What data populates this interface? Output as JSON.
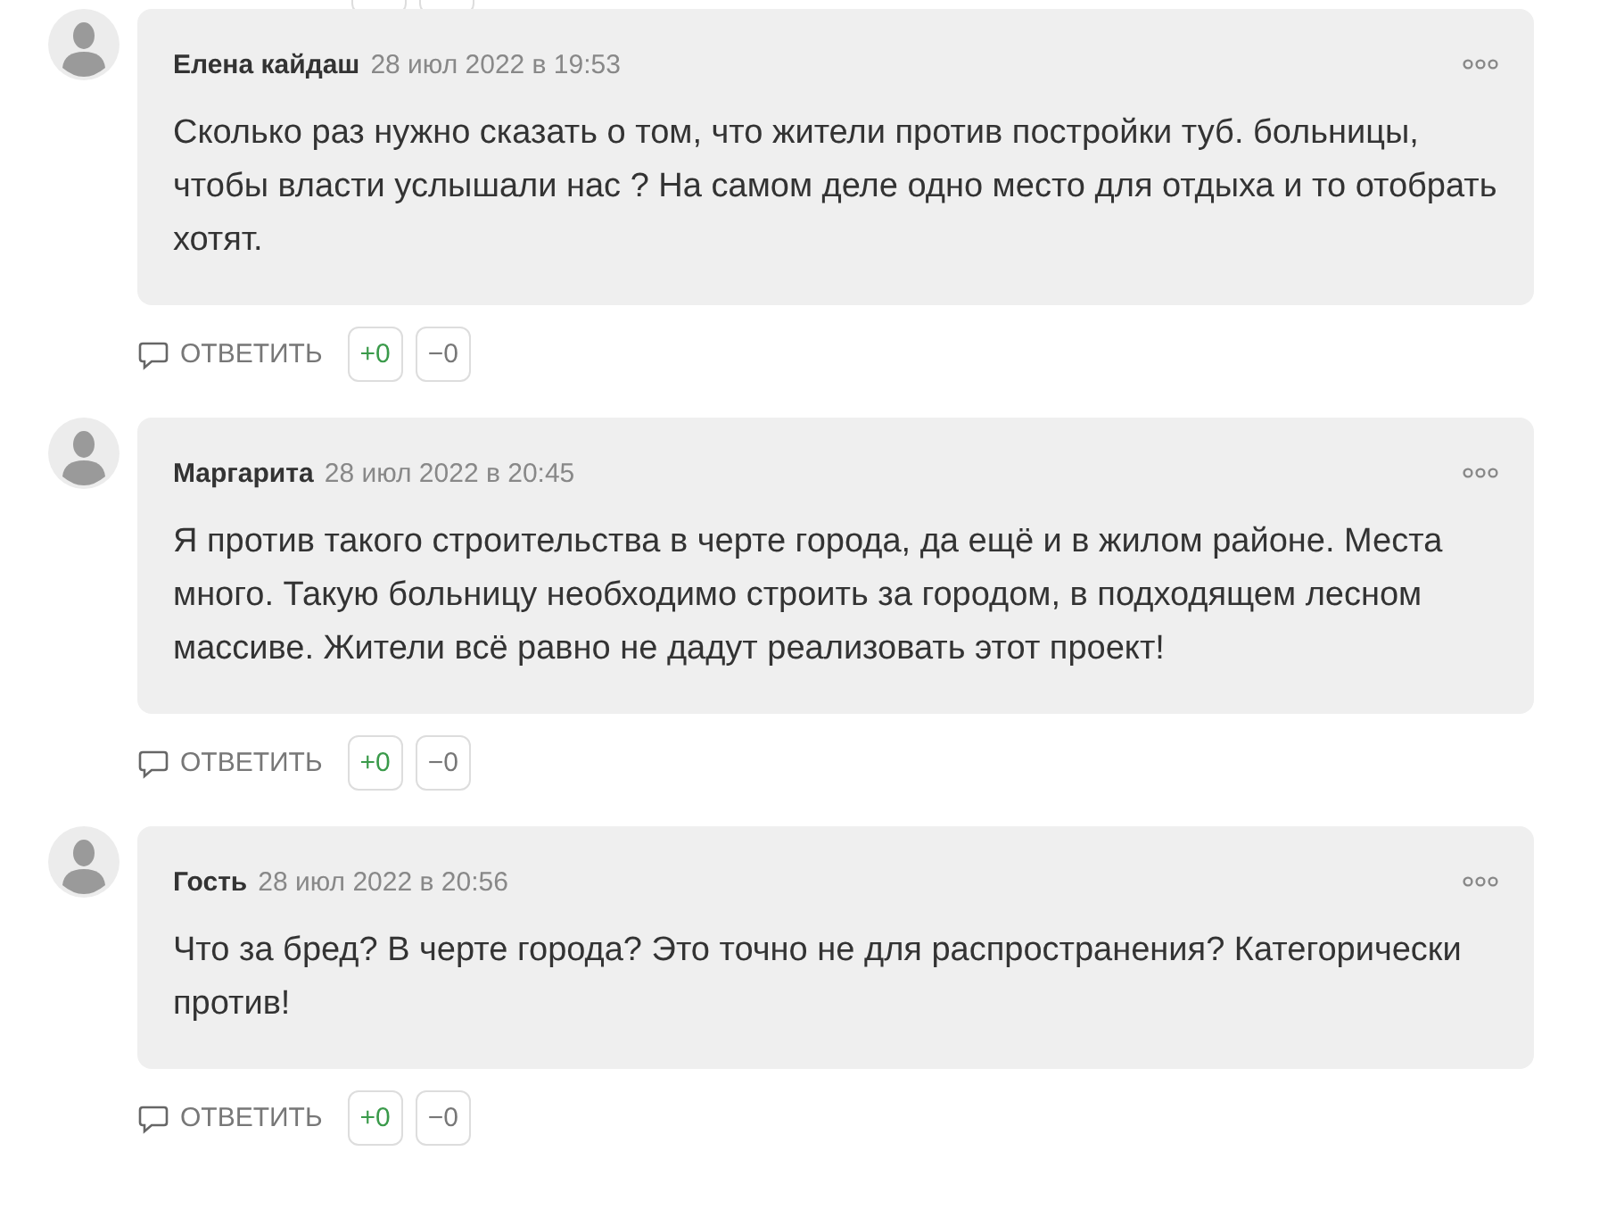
{
  "comments": [
    {
      "author": "Елена кайдаш",
      "date": "28 июл 2022 в 19:53",
      "text": "Сколько раз нужно сказать о том, что жители против постройки туб. больницы, чтобы власти услышали нас ? На самом деле одно место для отдыха и то отобрать хотят.",
      "reply": "ОТВЕТИТЬ",
      "upvotes": "+0",
      "downvotes": "−0"
    },
    {
      "author": "Маргарита",
      "date": "28 июл 2022 в 20:45",
      "text": "Я против такого строительства в черте города, да ещё и в жилом районе. Места много. Такую больницу необходимо строить за городом, в подходящем лесном массиве. Жители всё равно не дадут реализовать этот проект!",
      "reply": "ОТВЕТИТЬ",
      "upvotes": "+0",
      "downvotes": "−0"
    },
    {
      "author": "Гость",
      "date": "28 июл 2022 в 20:56",
      "text": "Что за бред? В черте города? Это точно не для распространения? Категорически против!",
      "reply": "ОТВЕТИТЬ",
      "upvotes": "+0",
      "downvotes": "−0"
    }
  ]
}
